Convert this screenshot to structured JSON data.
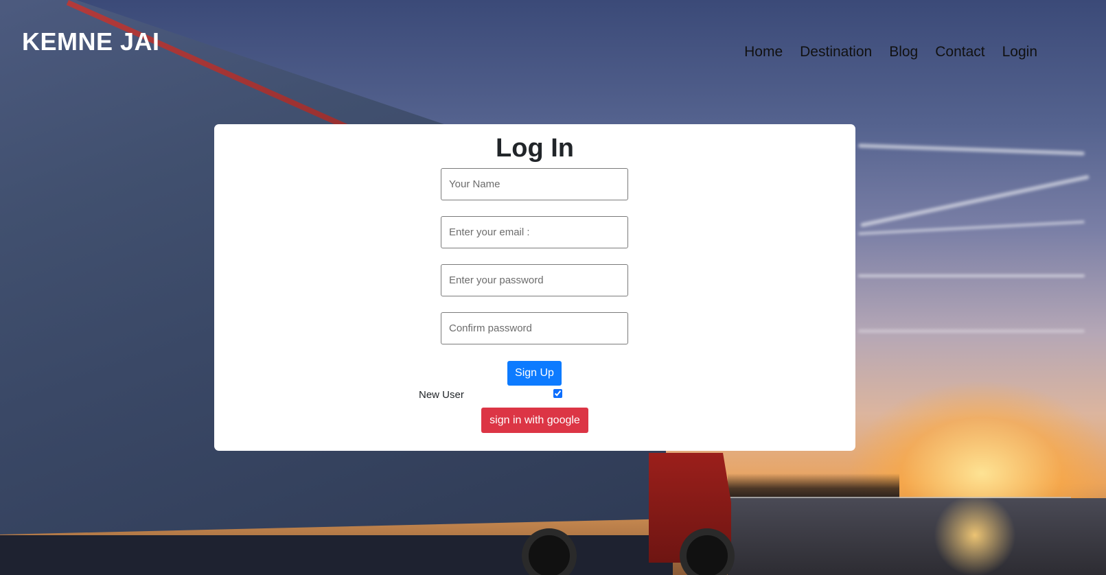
{
  "header": {
    "brand": "KEMNE JAI",
    "nav": [
      "Home",
      "Destination",
      "Blog",
      "Contact",
      "Login"
    ]
  },
  "form": {
    "title": "Log In",
    "name_placeholder": "Your Name",
    "email_placeholder": "Enter your email :",
    "password_placeholder": "Enter your password",
    "confirm_placeholder": "Confirm password",
    "signup_label": "Sign Up",
    "new_user_label": "New User",
    "new_user_checked": true,
    "google_label": "sign in with google"
  },
  "colors": {
    "primary": "#0d7bff",
    "danger": "#dc3545",
    "brand_text": "#ffffff"
  }
}
